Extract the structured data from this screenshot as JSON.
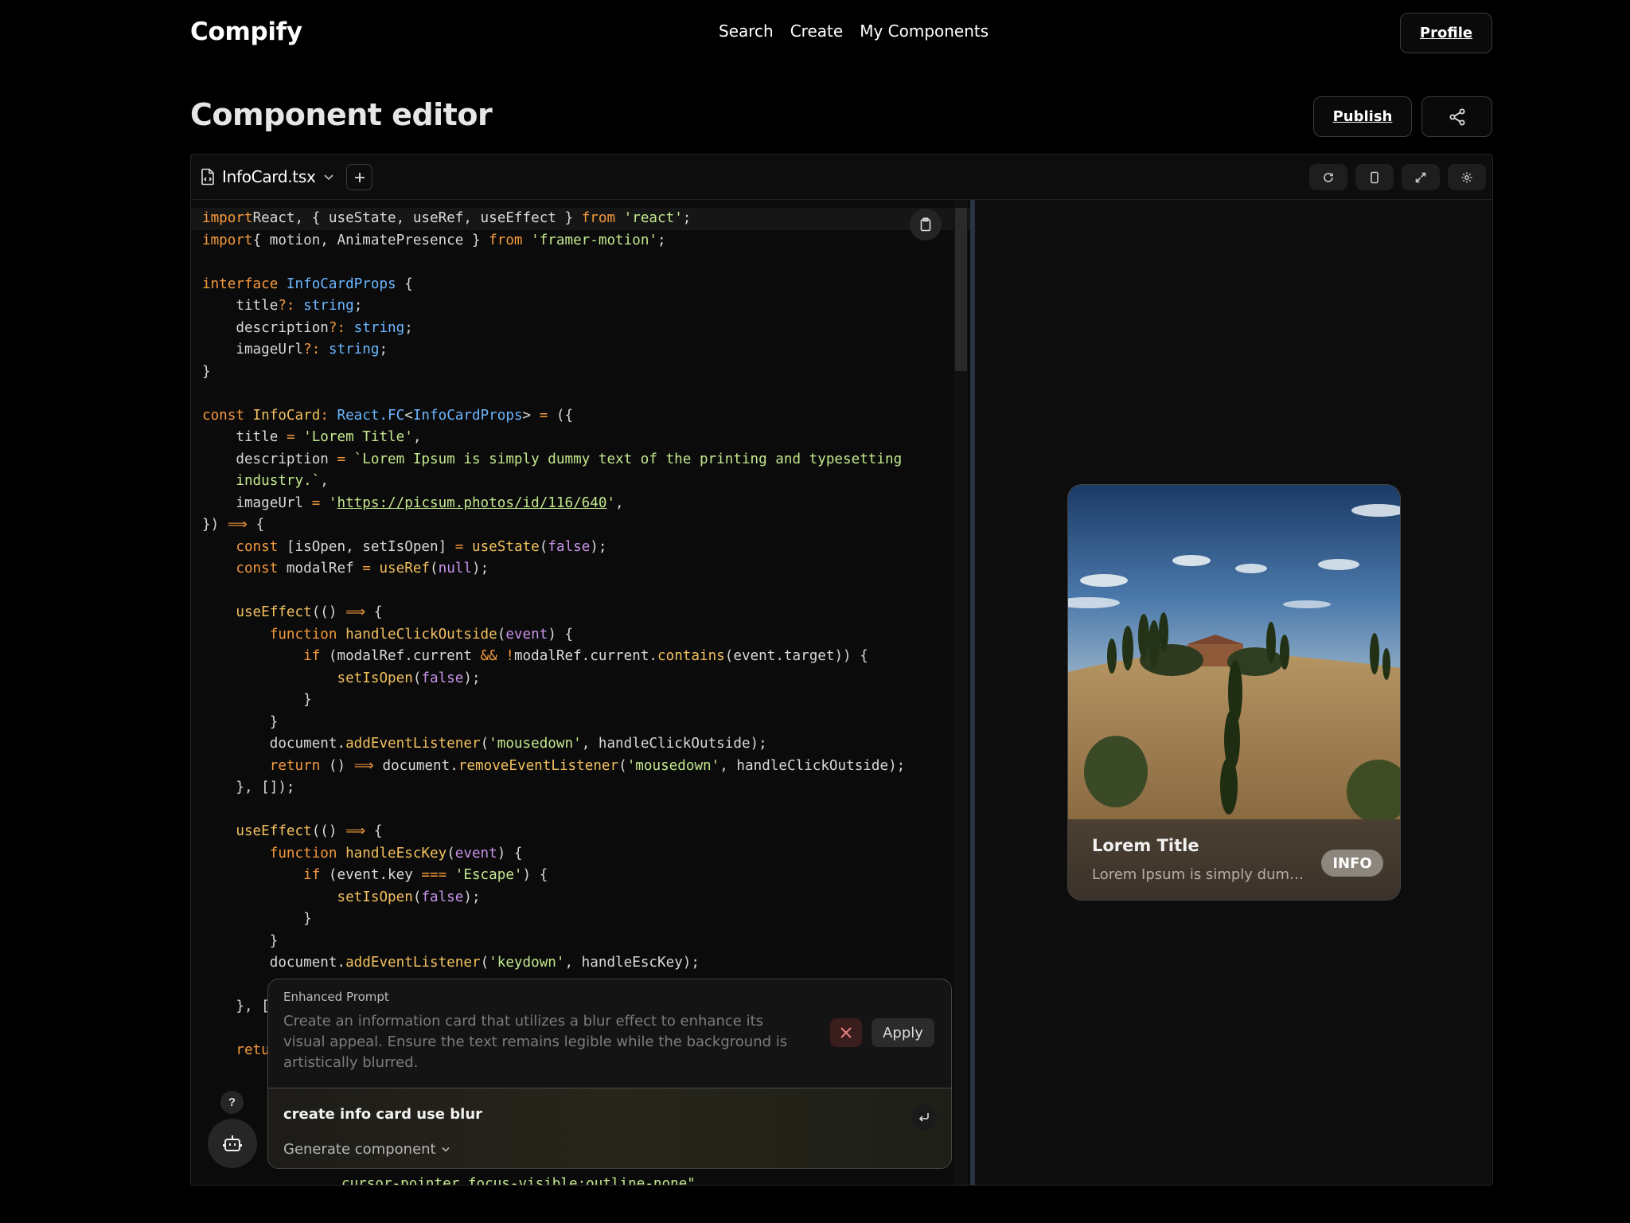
{
  "nav": {
    "logo": "Compify",
    "links": [
      "Search",
      "Create",
      "My Components"
    ],
    "profile_label": "Profile"
  },
  "page": {
    "title": "Component editor",
    "publish_label": "Publish"
  },
  "editor": {
    "file_name": "InfoCard.tsx",
    "toolbar_icons": [
      "refresh-icon",
      "mobile-icon",
      "expand-icon",
      "settings-icon"
    ],
    "code_lines": [
      [
        [
          "kw",
          "import"
        ],
        [
          "",
          "React, { useState, useRef, useEffect } "
        ],
        [
          "kw",
          "from"
        ],
        [
          "str",
          " 'react'"
        ],
        [
          "",
          ";"
        ]
      ],
      [
        [
          "kw",
          "import"
        ],
        [
          "",
          "{ motion, AnimatePresence } "
        ],
        [
          "kw",
          "from"
        ],
        [
          "str",
          " 'framer-motion'"
        ],
        [
          "",
          ";"
        ]
      ],
      [],
      [
        [
          "kw",
          "interface"
        ],
        [
          "ty",
          " InfoCardProps"
        ],
        [
          "",
          " {"
        ]
      ],
      [
        [
          "",
          "    title"
        ],
        [
          "kw",
          "?:"
        ],
        [
          "ty",
          " string"
        ],
        [
          "",
          ";"
        ]
      ],
      [
        [
          "",
          "    description"
        ],
        [
          "kw",
          "?:"
        ],
        [
          "ty",
          " string"
        ],
        [
          "",
          ";"
        ]
      ],
      [
        [
          "",
          "    imageUrl"
        ],
        [
          "kw",
          "?:"
        ],
        [
          "ty",
          " string"
        ],
        [
          "",
          ";"
        ]
      ],
      [
        [
          "",
          "}"
        ]
      ],
      [],
      [
        [
          "kw",
          "const"
        ],
        [
          "fn",
          " InfoCard"
        ],
        [
          "kw",
          ":"
        ],
        [
          "ty",
          " React.FC"
        ],
        [
          "",
          "<"
        ],
        [
          "ty",
          "InfoCardProps"
        ],
        [
          "",
          "> "
        ],
        [
          "kw",
          "="
        ],
        [
          "",
          " ({"
        ]
      ],
      [
        [
          "",
          "    title "
        ],
        [
          "kw",
          "="
        ],
        [
          "str",
          " 'Lorem Title'"
        ],
        [
          "",
          ","
        ]
      ],
      [
        [
          "",
          "    description "
        ],
        [
          "kw",
          "="
        ],
        [
          "str",
          " `Lorem Ipsum is simply dummy text of the printing and typesetting"
        ]
      ],
      [
        [
          "str",
          "    industry.`"
        ],
        [
          "",
          ","
        ]
      ],
      [
        [
          "",
          "    imageUrl "
        ],
        [
          "kw",
          "="
        ],
        [
          "str",
          " '"
        ],
        [
          "str link",
          "https://picsum.photos/id/116/640"
        ],
        [
          "str",
          "'"
        ],
        [
          "",
          ","
        ]
      ],
      [
        [
          "",
          "}) "
        ],
        [
          "kw",
          "⟹"
        ],
        [
          "",
          " {"
        ]
      ],
      [
        [
          "kw",
          "    const"
        ],
        [
          "",
          " [isOpen, setIsOpen] "
        ],
        [
          "kw",
          "="
        ],
        [
          "fn",
          " useState"
        ],
        [
          "",
          "("
        ],
        [
          "pu",
          "false"
        ],
        [
          "",
          ");"
        ]
      ],
      [
        [
          "kw",
          "    const"
        ],
        [
          "",
          " modalRef "
        ],
        [
          "kw",
          "="
        ],
        [
          "fn",
          " useRef"
        ],
        [
          "",
          "("
        ],
        [
          "pu",
          "null"
        ],
        [
          "",
          ");"
        ]
      ],
      [],
      [
        [
          "fn",
          "    useEffect"
        ],
        [
          "",
          "(() "
        ],
        [
          "kw",
          "⟹"
        ],
        [
          "",
          " {"
        ]
      ],
      [
        [
          "kw",
          "        function"
        ],
        [
          "fn",
          " handleClickOutside"
        ],
        [
          "",
          "("
        ],
        [
          "pu",
          "event"
        ],
        [
          "",
          ") {"
        ]
      ],
      [
        [
          "kw",
          "            if"
        ],
        [
          "",
          " (modalRef.current "
        ],
        [
          "kw",
          "&&"
        ],
        [
          "kw",
          " !"
        ],
        [
          "",
          "modalRef.current."
        ],
        [
          "fn",
          "contains"
        ],
        [
          "",
          "(event.target)) {"
        ]
      ],
      [
        [
          "fn",
          "                setIsOpen"
        ],
        [
          "",
          "("
        ],
        [
          "pu",
          "false"
        ],
        [
          "",
          ");"
        ]
      ],
      [
        [
          "",
          "            }"
        ]
      ],
      [
        [
          "",
          "        }"
        ]
      ],
      [
        [
          "",
          "        document."
        ],
        [
          "fn",
          "addEventListener"
        ],
        [
          "",
          "("
        ],
        [
          "str",
          "'mousedown'"
        ],
        [
          "",
          ", handleClickOutside);"
        ]
      ],
      [
        [
          "kw",
          "        return"
        ],
        [
          "",
          " () "
        ],
        [
          "kw",
          "⟹"
        ],
        [
          "",
          " document."
        ],
        [
          "fn",
          "removeEventListener"
        ],
        [
          "",
          "("
        ],
        [
          "str",
          "'mousedown'"
        ],
        [
          "",
          ", handleClickOutside);"
        ]
      ],
      [
        [
          "",
          "    }, []);"
        ]
      ],
      [],
      [
        [
          "fn",
          "    useEffect"
        ],
        [
          "",
          "(() "
        ],
        [
          "kw",
          "⟹"
        ],
        [
          "",
          " {"
        ]
      ],
      [
        [
          "kw",
          "        function"
        ],
        [
          "fn",
          " handleEscKey"
        ],
        [
          "",
          "("
        ],
        [
          "pu",
          "event"
        ],
        [
          "",
          ") {"
        ]
      ],
      [
        [
          "kw",
          "            if"
        ],
        [
          "",
          " (event.key "
        ],
        [
          "kw",
          "==="
        ],
        [
          "str",
          " 'Escape'"
        ],
        [
          "",
          ") {"
        ]
      ],
      [
        [
          "fn",
          "                setIsOpen"
        ],
        [
          "",
          "("
        ],
        [
          "pu",
          "false"
        ],
        [
          "",
          ");"
        ]
      ],
      [
        [
          "",
          "            }"
        ]
      ],
      [
        [
          "",
          "        }"
        ]
      ],
      [
        [
          "",
          "        document."
        ],
        [
          "fn",
          "addEventListener"
        ],
        [
          "",
          "("
        ],
        [
          "str",
          "'keydown'"
        ],
        [
          "",
          ", handleEscKey);"
        ]
      ],
      [],
      [
        [
          "",
          "    }, ["
        ]
      ],
      [],
      [
        [
          "kw",
          "    retu"
        ]
      ]
    ],
    "behind_overlay_text": "cursor-pointer focus-visible:outline-none\""
  },
  "preview": {
    "card": {
      "title": "Lorem Title",
      "description": "Lorem Ipsum is simply dummy text of the printing and typesetting industry.",
      "badge": "INFO"
    }
  },
  "assistant": {
    "help_label": "?",
    "enhanced_label": "Enhanced Prompt",
    "enhanced_text": "Create an information card that utilizes a blur effect to enhance its visual appeal. Ensure the text remains legible while the background is artistically blurred.",
    "apply_label": "Apply",
    "prompt_value": "create info card use blur",
    "mode_label": "Generate component"
  }
}
